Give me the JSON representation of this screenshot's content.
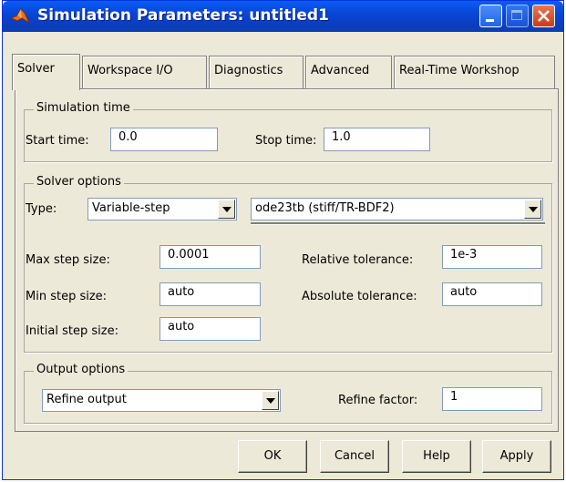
{
  "window": {
    "title": "Simulation Parameters: untitled1"
  },
  "tabs": [
    {
      "label": "Solver",
      "active": true
    },
    {
      "label": "Workspace I/O"
    },
    {
      "label": "Diagnostics"
    },
    {
      "label": "Advanced"
    },
    {
      "label": "Real-Time Workshop"
    }
  ],
  "simulation_time": {
    "title": "Simulation time",
    "start_label": "Start time:",
    "start_value": "0.0",
    "stop_label": "Stop time:",
    "stop_value": "1.0"
  },
  "solver_options": {
    "title": "Solver options",
    "type_label": "Type:",
    "type_value": "Variable-step",
    "solver_value": "ode23tb (stiff/TR-BDF2)",
    "max_step_label": "Max step size:",
    "max_step_value": "0.0001",
    "min_step_label": "Min step size:",
    "min_step_value": "auto",
    "initial_step_label": "Initial step size:",
    "initial_step_value": "auto",
    "rel_tol_label": "Relative tolerance:",
    "rel_tol_value": "1e-3",
    "abs_tol_label": "Absolute tolerance:",
    "abs_tol_value": "auto"
  },
  "output_options": {
    "title": "Output options",
    "mode_value": "Refine output",
    "refine_label": "Refine factor:",
    "refine_value": "1"
  },
  "buttons": {
    "ok": "OK",
    "cancel": "Cancel",
    "help": "Help",
    "apply": "Apply"
  },
  "colors": {
    "titlebar": "#0a4fe0",
    "dialog_bg": "#ece9d8",
    "close_button": "#d8532b"
  }
}
